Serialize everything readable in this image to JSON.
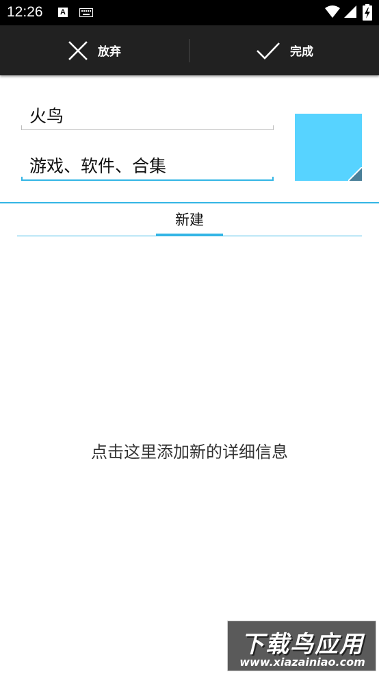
{
  "status_bar": {
    "time": "12:26",
    "a_icon": "A"
  },
  "action_bar": {
    "discard_label": "放弃",
    "done_label": "完成"
  },
  "form": {
    "name_value": "火鸟",
    "group_value": "游戏、软件、合集"
  },
  "colors": {
    "accent": "#33b5e5",
    "swatch": "#57d3ff",
    "action_bar_bg": "#212121"
  },
  "tabs": {
    "new_label": "新建"
  },
  "main": {
    "add_details": "点击这里添加新的详细信息"
  },
  "watermark": {
    "title": "下载鸟应用",
    "url": "www.xiazainiao.com"
  }
}
